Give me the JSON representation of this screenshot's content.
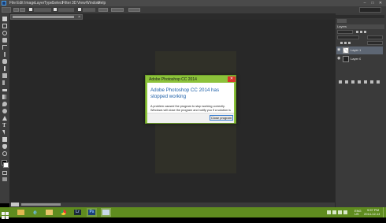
{
  "app": {
    "logo": "Ps",
    "menu": [
      "File",
      "Edit",
      "Image",
      "Layer",
      "Type",
      "Select",
      "Filter",
      "3D",
      "View",
      "Window",
      "Help"
    ],
    "window_controls": [
      "–",
      "□",
      "✕"
    ]
  },
  "document": {
    "tab_close": "×",
    "status_zoom": ""
  },
  "panels": {
    "layers": {
      "title": "Layers",
      "items": [
        {
          "name": "Layer 1",
          "selected": true
        },
        {
          "name": "Layer 0",
          "selected": false
        }
      ]
    }
  },
  "dialog": {
    "title": "Adobe Photoshop CC 2014",
    "close_glyph": "✕",
    "heading": "Adobe Photoshop CC 2014 has stopped working",
    "message": "A problem caused the program to stop working correctly. Windows will close the program and notify you if a solution is available.",
    "button_label": "Close program"
  },
  "taskbar": {
    "icons": [
      "file-explorer-icon",
      "internet-explorer-icon",
      "file-manager-icon",
      "chrome-icon",
      "lightroom-icon",
      "photoshop-icon",
      "tool-icon"
    ],
    "lr_label": "Lr",
    "ps_label": "Ps",
    "lang": "ENG",
    "lang2": "US",
    "time": "9:57 PM",
    "date": "2014-12-14",
    "accent": "#5f8c1f"
  },
  "colors": {
    "dialog_title_bar": "#8cc23a",
    "dialog_heading": "#1c5fa8",
    "dialog_close": "#d9342b",
    "ps_blue": "#1b3f78"
  }
}
